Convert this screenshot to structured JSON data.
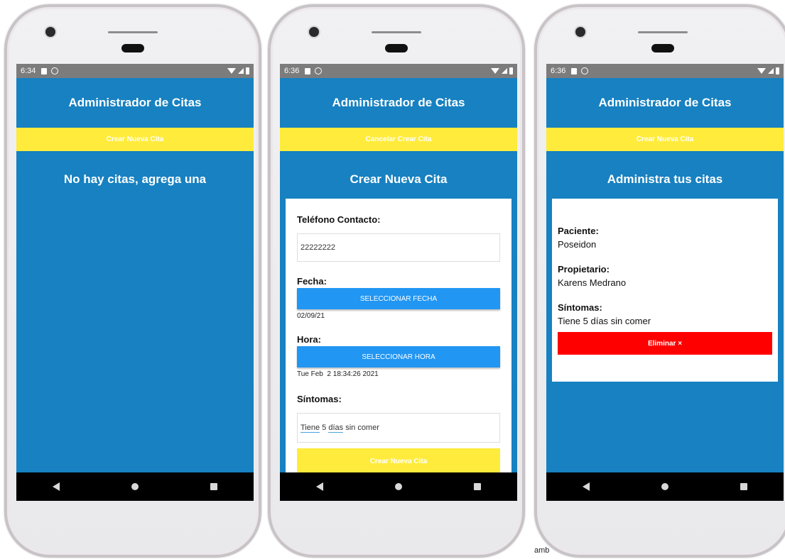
{
  "phones": [
    {
      "time": "6:34",
      "title": "Administrador de Citas",
      "top_button": "Crear Nueva Cita",
      "message": "No hay citas, agrega una"
    },
    {
      "time": "6:36",
      "title": "Administrador de Citas",
      "top_button": "Cancelar Crear Cita",
      "heading": "Crear Nueva Cita",
      "form": {
        "telefono_label": "Teléfono Contacto:",
        "telefono_value": "22222222",
        "fecha_label": "Fecha:",
        "fecha_button": "SELECCIONAR FECHA",
        "fecha_value": "02/09/21",
        "hora_label": "Hora:",
        "hora_button": "SELECCIONAR HORA",
        "hora_value": "Tue Feb  2 18:34:26 2021",
        "sintomas_label": "Síntomas:",
        "sintomas_word1": "Tiene",
        "sintomas_word2": " 5 ",
        "sintomas_word3": "días",
        "sintomas_rest": " sin comer",
        "submit": "Crear Nueva Cita"
      }
    },
    {
      "time": "6:36",
      "title": "Administrador de Citas",
      "top_button": "Crear Nueva Cita",
      "heading": "Administra tus citas",
      "cita": {
        "paciente_label": "Paciente:",
        "paciente": "Poseidon",
        "propietario_label": "Propietario:",
        "propietario": "Karens Medrano",
        "sintomas_label": "Síntomas:",
        "sintomas": "Tiene 5 días sin comer",
        "delete": "Eliminar ×"
      }
    }
  ],
  "stray_text": "amb",
  "colors": {
    "app_blue": "#1781c1",
    "yellow": "#ffeb3b",
    "button_blue": "#2196f3",
    "delete_red": "#ff0000"
  }
}
